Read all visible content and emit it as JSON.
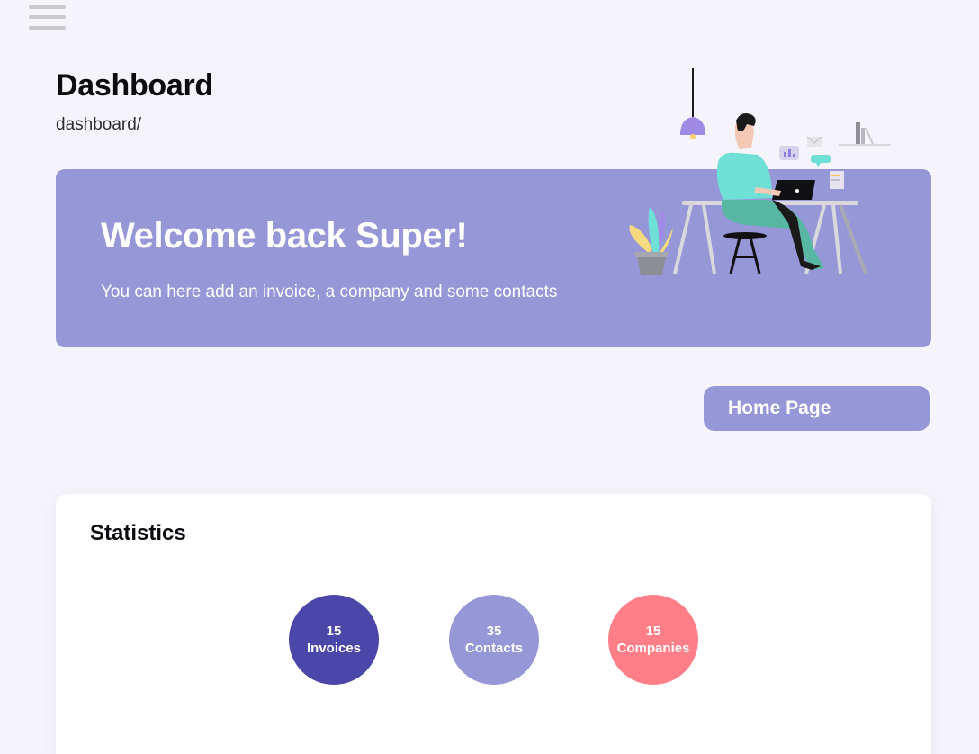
{
  "header": {
    "menu_icon": "hamburger-menu-icon",
    "title": "Dashboard",
    "breadcrumb": "dashboard/"
  },
  "banner": {
    "title": "Welcome back Super!",
    "subtitle": "You can here add an invoice, a company and some contacts",
    "background": "#9597d6",
    "illustration": "person-working-at-desk-illustration"
  },
  "home_button": {
    "label": "Home Page",
    "background": "#9597d6"
  },
  "statistics": {
    "title": "Statistics",
    "items": [
      {
        "count": "15",
        "label": "Invoices",
        "color": "#4a47a8"
      },
      {
        "count": "35",
        "label": "Contacts",
        "color": "#9597d6"
      },
      {
        "count": "15",
        "label": "Companies",
        "color": "#ff7e88"
      }
    ]
  }
}
